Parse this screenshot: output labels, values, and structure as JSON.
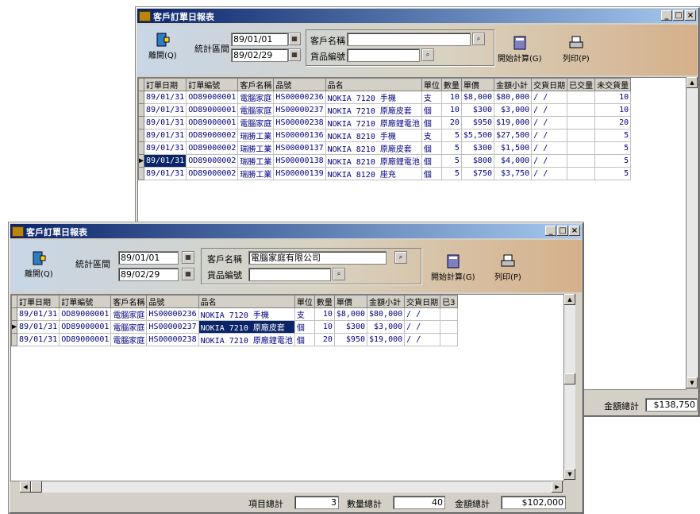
{
  "back_window": {
    "title": "客戶訂單日報表",
    "controls": [
      "_",
      "□",
      "×"
    ],
    "exit_label": "離開(Q)",
    "date_range_label": "統計區間",
    "date_from": "89/01/01",
    "date_to": "89/02/29",
    "customer_label": "客戶名稱",
    "customer_value": "",
    "product_label": "貨品編號",
    "product_value": "",
    "calc_label": "開始計算(G)",
    "print_label": "列印(P)",
    "columns": [
      "訂單日期",
      "訂單編號",
      "客戶名稱",
      "品號",
      "品名",
      "單位",
      "數量",
      "單價",
      "金額小計",
      "交貨日期",
      "已交量",
      "未交貨量"
    ],
    "rows": [
      [
        "89/01/31",
        "OD89000001",
        "電腦家庭",
        "HS00000236",
        "NOKIA 7120 手機",
        "支",
        "10",
        "$8,000",
        "$80,000",
        "/ /",
        "",
        "10"
      ],
      [
        "89/01/31",
        "OD89000001",
        "電腦家庭",
        "HS00000237",
        "NOKIA 7210 原廠皮套",
        "個",
        "10",
        "$300",
        "$3,000",
        "/ /",
        "",
        "10"
      ],
      [
        "89/01/31",
        "OD89000001",
        "電腦家庭",
        "HS00000238",
        "NOKIA 7210 原廠鋰電池",
        "個",
        "20",
        "$950",
        "$19,000",
        "/ /",
        "",
        "20"
      ],
      [
        "89/01/31",
        "OD89000002",
        "瑞勝工業",
        "HS00000136",
        "NOKIA 8210 手機",
        "支",
        "5",
        "$5,500",
        "$27,500",
        "/ /",
        "",
        "5"
      ],
      [
        "89/01/31",
        "OD89000002",
        "瑞勝工業",
        "HS00000137",
        "NOKIA 8210 原廠皮套",
        "個",
        "5",
        "$300",
        "$1,500",
        "/ /",
        "",
        "5"
      ],
      [
        "89/01/31",
        "OD89000002",
        "瑞勝工業",
        "HS00000138",
        "NOKIA 8210 原廠鋰電池",
        "個",
        "5",
        "$800",
        "$4,000",
        "/ /",
        "",
        "5"
      ],
      [
        "89/01/31",
        "OD89000002",
        "瑞勝工業",
        "HS00000139",
        "NOKIA 8120 座充",
        "個",
        "5",
        "$750",
        "$3,750",
        "/ /",
        "",
        "5"
      ]
    ],
    "amount_total_label": "金額總計",
    "amount_total_value": "$138,750"
  },
  "front_window": {
    "title": "客戶訂單日報表",
    "controls": [
      "_",
      "□",
      "×"
    ],
    "exit_label": "離開(Q)",
    "date_range_label": "統計區間",
    "date_from": "89/01/01",
    "date_to": "89/02/29",
    "customer_label": "客戶名稱",
    "customer_value": "電腦家庭有限公司",
    "product_label": "貨品編號",
    "product_value": "",
    "calc_label": "開始計算(G)",
    "print_label": "列印(P)",
    "columns": [
      "訂單日期",
      "訂單編號",
      "客戶名稱",
      "品號",
      "品名",
      "單位",
      "數量",
      "單價",
      "金額小計",
      "交貨日期",
      "已3"
    ],
    "rows": [
      [
        "89/01/31",
        "OD89000001",
        "電腦家庭",
        "HS00000236",
        "NOKIA 7120 手機",
        "支",
        "10",
        "$8,000",
        "$80,000",
        "/ /",
        ""
      ],
      [
        "89/01/31",
        "OD89000001",
        "電腦家庭",
        "HS00000237",
        "NOKIA 7210 原廠皮套",
        "個",
        "10",
        "$300",
        "$3,000",
        "/ /",
        ""
      ],
      [
        "89/01/31",
        "OD89000001",
        "電腦家庭",
        "HS00000238",
        "NOKIA 7210 原廠鋰電池",
        "個",
        "20",
        "$950",
        "$19,000",
        "/ /",
        ""
      ]
    ],
    "item_total_label": "項目總計",
    "item_total_value": "3",
    "qty_total_label": "數量總計",
    "qty_total_value": "40",
    "amount_total_label": "金額總計",
    "amount_total_value": "$102,000"
  },
  "icons": {
    "exit": "exit-door-icon",
    "calendar": "calendar-icon",
    "lookup": "lookup-icon",
    "calc": "calculator-icon",
    "print": "printer-icon"
  },
  "colors": {
    "title_active": "#0a246a",
    "selection": "#0a246a",
    "grid_text": "#000080"
  }
}
